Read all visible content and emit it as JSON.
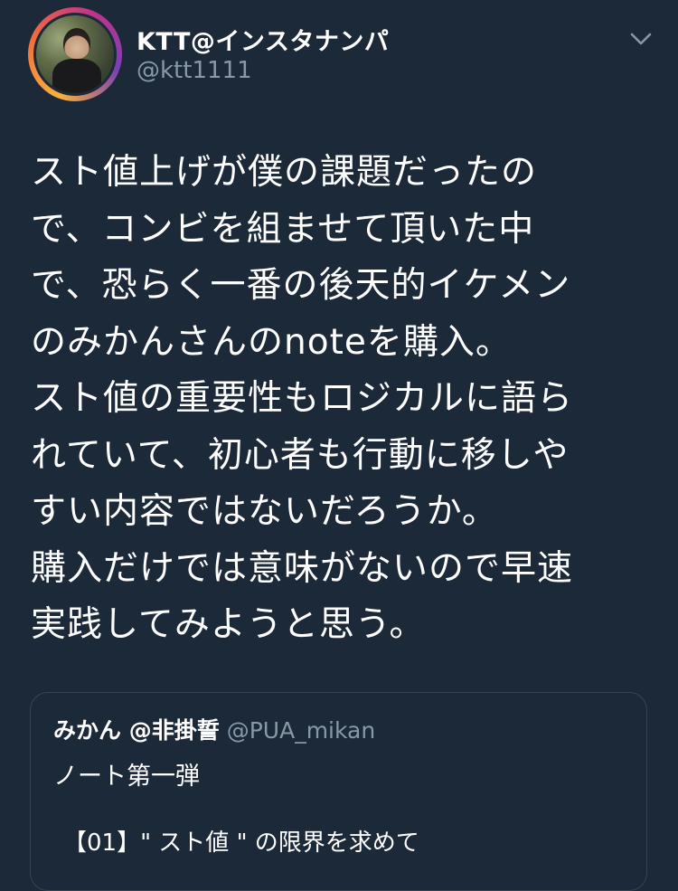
{
  "tweet": {
    "author": {
      "display_name": "KTT@インスタナンパ",
      "handle": "@ktt1111",
      "avatar_icon": "user-avatar-photo"
    },
    "menu_icon": "chevron-down-icon",
    "text_lines": [
      "スト値上げが僕の課題だったの",
      "で、コンビを組ませて頂いた中",
      "で、恐らく一番の後天的イケメン",
      "のみかんさんのnoteを購入。",
      "スト値の重要性もロジカルに語ら",
      "れていて、初心者も行動に移しや",
      "すい内容ではないだろうか。",
      "購入だけでは意味がないので早速",
      "実践してみようと思う。"
    ]
  },
  "quote": {
    "display_name": "みかん @非掛誓",
    "handle": "@PUA_mikan",
    "line1": "ノート第一弾",
    "line2": "【01】\" スト値 \" の限界を求めて"
  },
  "colors": {
    "background": "#1c2938",
    "text_primary": "#ffffff",
    "text_secondary": "#8899a6",
    "border": "#38444d"
  }
}
